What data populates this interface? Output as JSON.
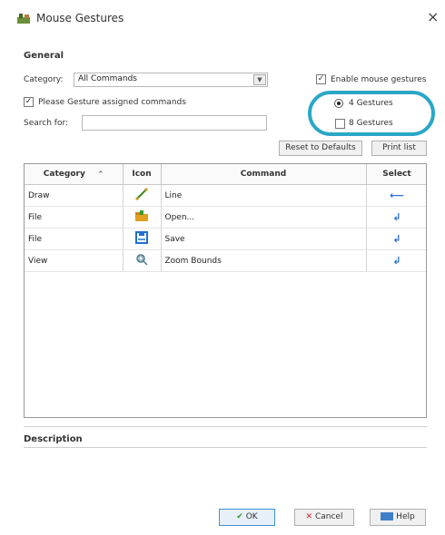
{
  "window": {
    "title": "Mouse Gestures",
    "close_glyph": "×",
    "icon": "mouse-gestures-app-icon"
  },
  "general": {
    "label": "General",
    "category_label": "Category:",
    "category_value": "All Commands",
    "show_assigned_label": "Please Gesture assigned commands",
    "show_assigned_checked": true,
    "search_label": "Search for:",
    "search_value": "",
    "search_placeholder": ""
  },
  "options": {
    "enable_label": "Enable mouse gestures",
    "enable_checked": true,
    "gestures_4_label": "4 Gestures",
    "gestures_4_selected": true,
    "gestures_8_label": "8 Gestures",
    "gestures_8_selected": false
  },
  "actions": {
    "reset_label": "Reset to Defaults",
    "print_label": "Print list"
  },
  "table": {
    "columns": [
      "Category",
      "Icon",
      "Command",
      "Select"
    ],
    "sort_glyph": "^",
    "rows": [
      {
        "category": "Draw",
        "icon": "line-tool-icon",
        "command": "Line",
        "select": "⟵"
      },
      {
        "category": "File",
        "icon": "open-folder-icon",
        "command": "Open...",
        "select": "↲"
      },
      {
        "category": "File",
        "icon": "save-icon",
        "command": "Save",
        "select": "↲"
      },
      {
        "category": "View",
        "icon": "zoom-bounds-icon",
        "command": "Zoom Bounds",
        "select": "↲"
      }
    ]
  },
  "description": {
    "label": "Description",
    "text": ""
  },
  "footer": {
    "ok_label": "OK",
    "cancel_label": "Cancel",
    "help_label": "Help",
    "ok_check_glyph": "✔",
    "cancel_x_glyph": "✕"
  },
  "colors": {
    "highlight_ring": "#2aa7c7",
    "select_arrow": "#2b6fd6"
  }
}
